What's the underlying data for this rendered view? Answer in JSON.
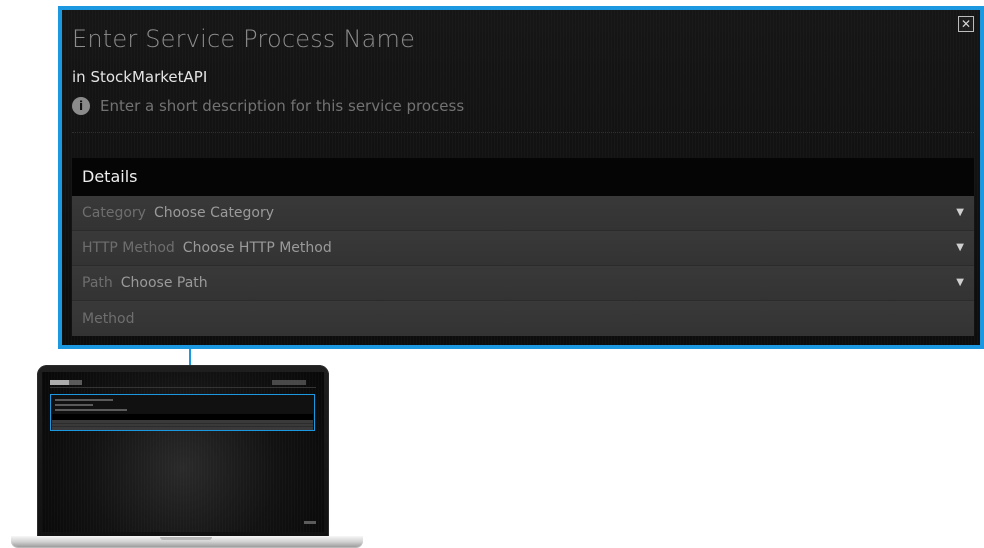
{
  "dialog": {
    "title": "Enter Service Process Name",
    "context": "in StockMarketAPI",
    "description": "Enter a short description for this service process",
    "close_symbol": "✕"
  },
  "details": {
    "title": "Details",
    "fields": [
      {
        "label": "Category",
        "value": "Choose Category",
        "has_dropdown": true
      },
      {
        "label": "HTTP Method",
        "value": "Choose HTTP Method",
        "has_dropdown": true
      },
      {
        "label": "Path",
        "value": "Choose Path",
        "has_dropdown": true
      },
      {
        "label": "Method",
        "value": "",
        "has_dropdown": false
      }
    ]
  },
  "icons": {
    "info": "i",
    "dropdown": "▼"
  },
  "colors": {
    "accent": "#1b98e0",
    "panel": "#111111",
    "field_background": "#363636",
    "text_muted": "#747474",
    "text_primary": "#e4e4e4"
  }
}
